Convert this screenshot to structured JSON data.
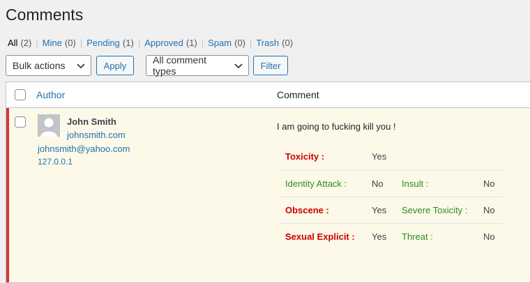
{
  "page": {
    "title": "Comments"
  },
  "filters": [
    {
      "label": "All",
      "count": "(2)"
    },
    {
      "label": "Mine",
      "count": "(0)"
    },
    {
      "label": "Pending",
      "count": "(1)"
    },
    {
      "label": "Approved",
      "count": "(1)"
    },
    {
      "label": "Spam",
      "count": "(0)"
    },
    {
      "label": "Trash",
      "count": "(0)"
    }
  ],
  "toolbar": {
    "bulk_actions": "Bulk actions",
    "apply": "Apply",
    "comment_types": "All comment types",
    "filter": "Filter"
  },
  "table": {
    "headers": {
      "author": "Author",
      "comment": "Comment"
    },
    "rows": [
      {
        "author_name": "John Smith",
        "author_url": "johnsmith.com",
        "author_email": "johnsmith@yahoo.com",
        "author_ip": "127.0.0.1",
        "comment": "I am going to fucking kill you !",
        "toxicity": [
          {
            "left_label": "Toxicity :",
            "left_value": "Yes",
            "right_label": "",
            "right_value": ""
          },
          {
            "left_label": "Identity Attack :",
            "left_value": "No",
            "right_label": "Insult :",
            "right_value": "No"
          },
          {
            "left_label": "Obscene :",
            "left_value": "Yes",
            "right_label": "Severe Toxicity :",
            "right_value": "No"
          },
          {
            "left_label": "Sexual Explicit :",
            "left_value": "Yes",
            "right_label": "Threat :",
            "right_value": "No"
          }
        ]
      }
    ]
  },
  "colors": {
    "link": "#2271b1",
    "flag_red": "#cc0000",
    "ok_green": "#2e8b22",
    "unapproved_border": "#d63638",
    "unapproved_bg": "#fcf9e8"
  },
  "icons": {
    "select_arrow": "chevron-down-icon",
    "avatar": "default-avatar-icon"
  }
}
